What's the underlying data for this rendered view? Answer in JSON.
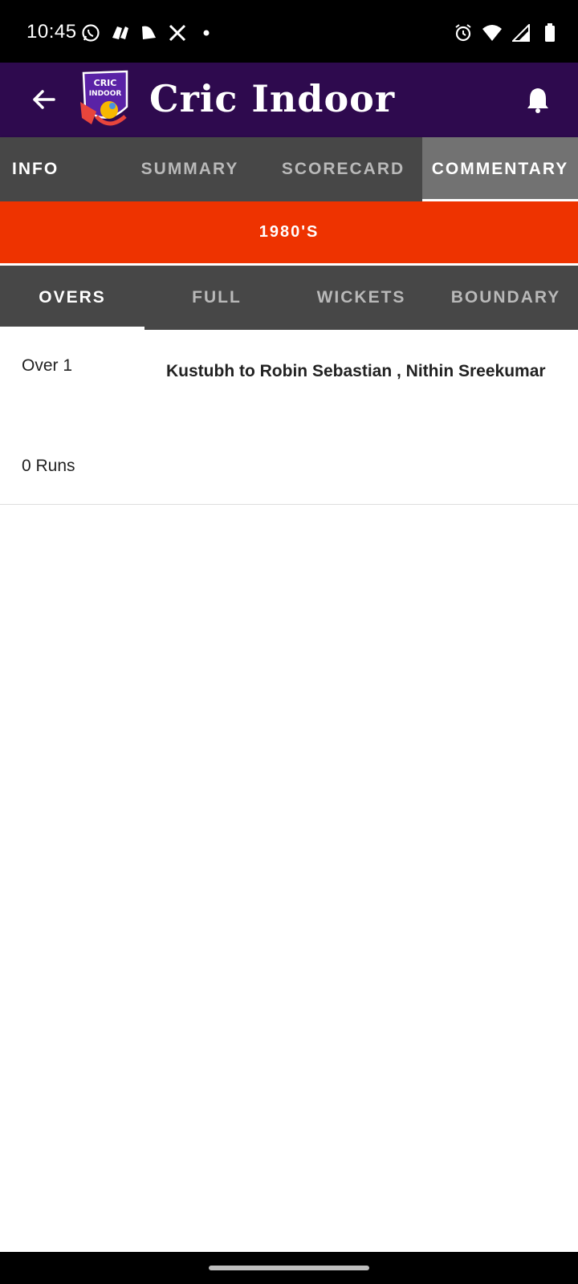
{
  "status_bar": {
    "time": "10:45",
    "left_icons": [
      "whatsapp-icon",
      "app-notification-icon",
      "bell-app-icon",
      "x-icon",
      "dot-icon"
    ],
    "right_icons": [
      "alarm-icon",
      "wifi-icon",
      "signal-icon",
      "battery-icon"
    ]
  },
  "app_bar": {
    "title": "Cric Indoor",
    "logo_text_line1": "CRIC",
    "logo_text_line2": "INDOOR",
    "colors": {
      "background": "#2e0a4e"
    }
  },
  "main_tabs": [
    {
      "label": "INFO",
      "active": false
    },
    {
      "label": "SUMMARY",
      "active": false
    },
    {
      "label": "SCORECARD",
      "active": false
    },
    {
      "label": "COMMENTARY",
      "active": true
    }
  ],
  "team_banner": {
    "label": "1980'S",
    "color": "#ee3300"
  },
  "sub_tabs": [
    {
      "label": "OVERS",
      "active": true
    },
    {
      "label": "FULL",
      "active": false
    },
    {
      "label": "WICKETS",
      "active": false
    },
    {
      "label": "BOUNDARY",
      "active": false
    }
  ],
  "overs": [
    {
      "over": "Over 1",
      "bowler_batsmen": "Kustubh to Robin Sebastian , Nithin Sreekumar",
      "runs": "0 Runs"
    }
  ]
}
